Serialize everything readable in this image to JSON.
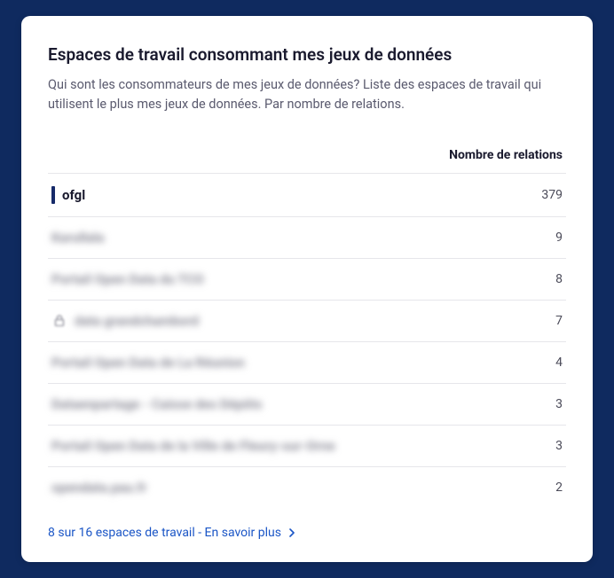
{
  "card": {
    "title": "Espaces de travail consommant mes jeux de données",
    "subtitle": "Qui sont les consommateurs de mes jeux de données? Liste des espaces de travail qui utilisent le plus mes jeux de données. Par nombre de relations."
  },
  "table": {
    "header_value": "Nombre de relations",
    "rows": [
      {
        "name": "ofgl",
        "value": "379",
        "highlighted": true,
        "blurred": false,
        "locked": false
      },
      {
        "name": "Karullala",
        "value": "9",
        "highlighted": false,
        "blurred": true,
        "locked": false
      },
      {
        "name": "Portail Open Data du TCO",
        "value": "8",
        "highlighted": false,
        "blurred": true,
        "locked": false
      },
      {
        "name": "data grandchambord",
        "value": "7",
        "highlighted": false,
        "blurred": true,
        "locked": true
      },
      {
        "name": "Portail Open Data de La Réunion",
        "value": "4",
        "highlighted": false,
        "blurred": true,
        "locked": false
      },
      {
        "name": "Dataenpartage - Caisse des Dépôts",
        "value": "3",
        "highlighted": false,
        "blurred": true,
        "locked": false
      },
      {
        "name": "Portail Open Data de la Ville de Fleury-sur-Orne",
        "value": "3",
        "highlighted": false,
        "blurred": true,
        "locked": false
      },
      {
        "name": "opendata.pau.fr",
        "value": "2",
        "highlighted": false,
        "blurred": true,
        "locked": false
      }
    ]
  },
  "footer": {
    "link_text": "8 sur 16 espaces de travail - En savoir plus"
  }
}
